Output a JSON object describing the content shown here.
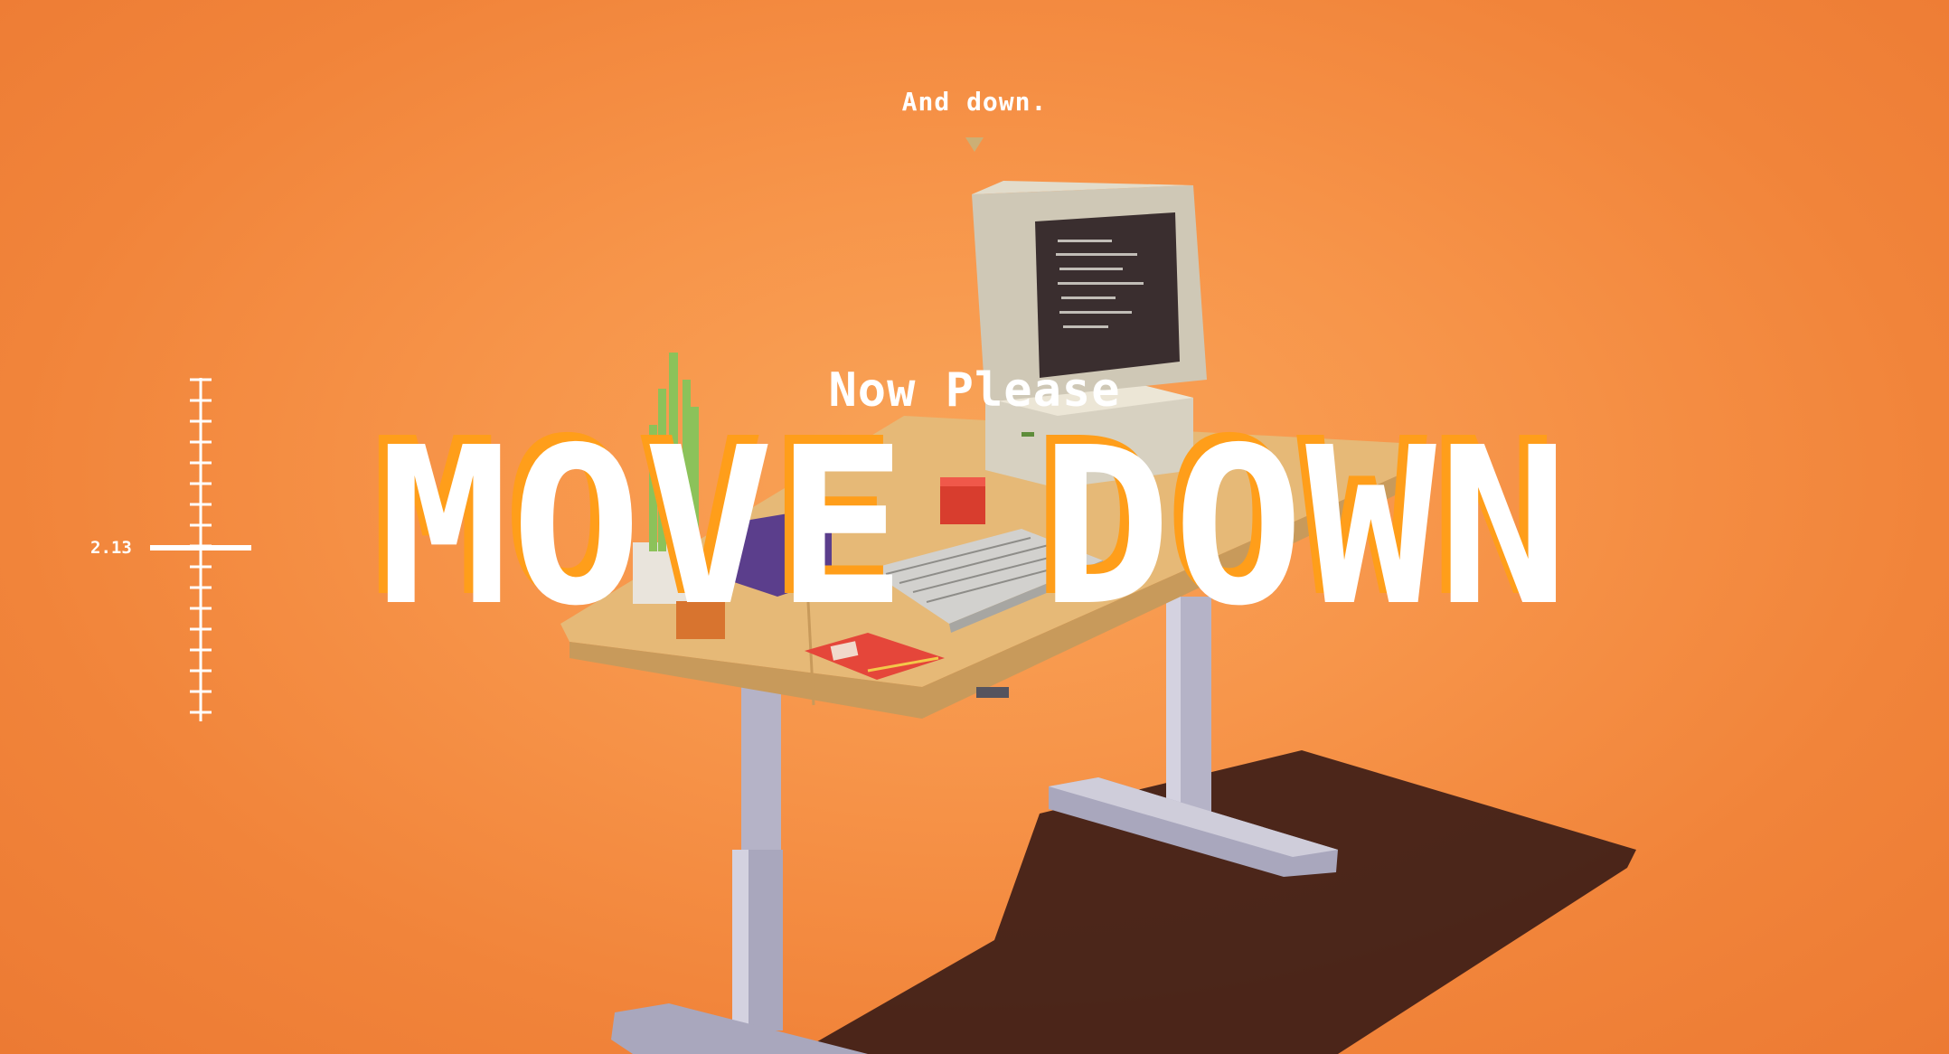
{
  "hud": {
    "hint_text": "And down.",
    "prompt_small": "Now Please",
    "prompt_big": "MOVE DOWN",
    "height_value": "2.13"
  },
  "colors": {
    "background": "#f7954a",
    "prompt_accent": "#ff9e1a",
    "text": "#ffffff",
    "desk_top": "#e9bd7a",
    "desk_legs": "#b7b4c9",
    "shadow": "#3d1d17"
  },
  "icons": {
    "hint_arrow": "down-arrow-icon"
  }
}
